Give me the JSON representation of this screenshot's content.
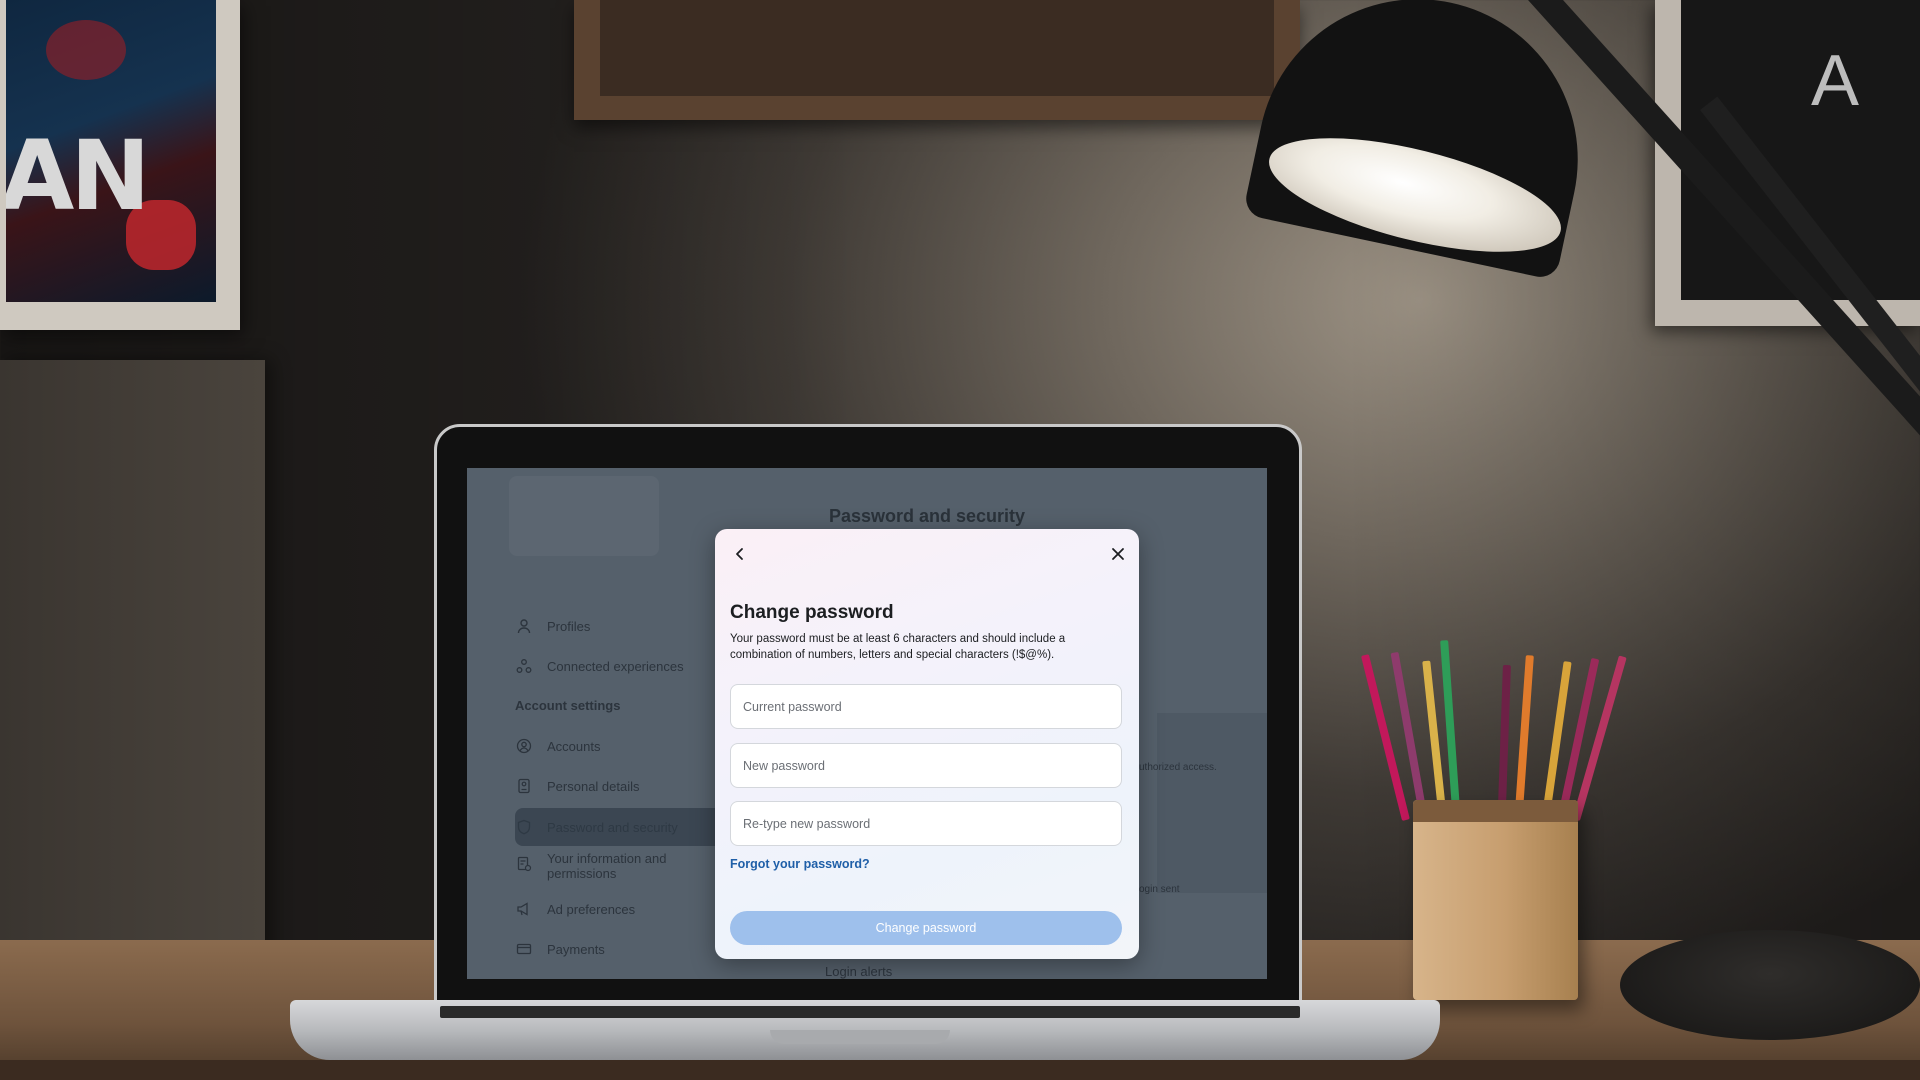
{
  "scene": {
    "poster_left_text": "AN",
    "poster_right_text": "A"
  },
  "page": {
    "title": "Password and security",
    "sidebar": {
      "items_top": [
        {
          "label": "Profiles",
          "icon": "person-icon"
        },
        {
          "label": "Connected experiences",
          "icon": "connected-icon"
        }
      ],
      "section_heading": "Account settings",
      "items": [
        {
          "label": "Accounts",
          "icon": "account-circle-icon"
        },
        {
          "label": "Personal details",
          "icon": "id-card-icon"
        },
        {
          "label": "Password and security",
          "icon": "shield-icon",
          "active": true
        },
        {
          "label": "Your information and permissions",
          "icon": "info-doc-icon"
        },
        {
          "label": "Ad preferences",
          "icon": "megaphone-icon"
        },
        {
          "label": "Payments",
          "icon": "card-icon"
        }
      ]
    },
    "right_snippets": [
      "uthorized access.",
      "ogin sent"
    ],
    "bottom_item": "Login alerts"
  },
  "modal": {
    "title": "Change password",
    "description": "Your password must be at least 6 characters and should include a combination of numbers, letters and special characters (!$@%).",
    "fields": [
      {
        "placeholder": "Current password",
        "value": ""
      },
      {
        "placeholder": "New password",
        "value": ""
      },
      {
        "placeholder": "Re-type new password",
        "value": ""
      }
    ],
    "forgot_link": "Forgot your password?",
    "submit_label": "Change password",
    "submit_color": "#9ec0ec",
    "link_color": "#1f5fa8"
  }
}
